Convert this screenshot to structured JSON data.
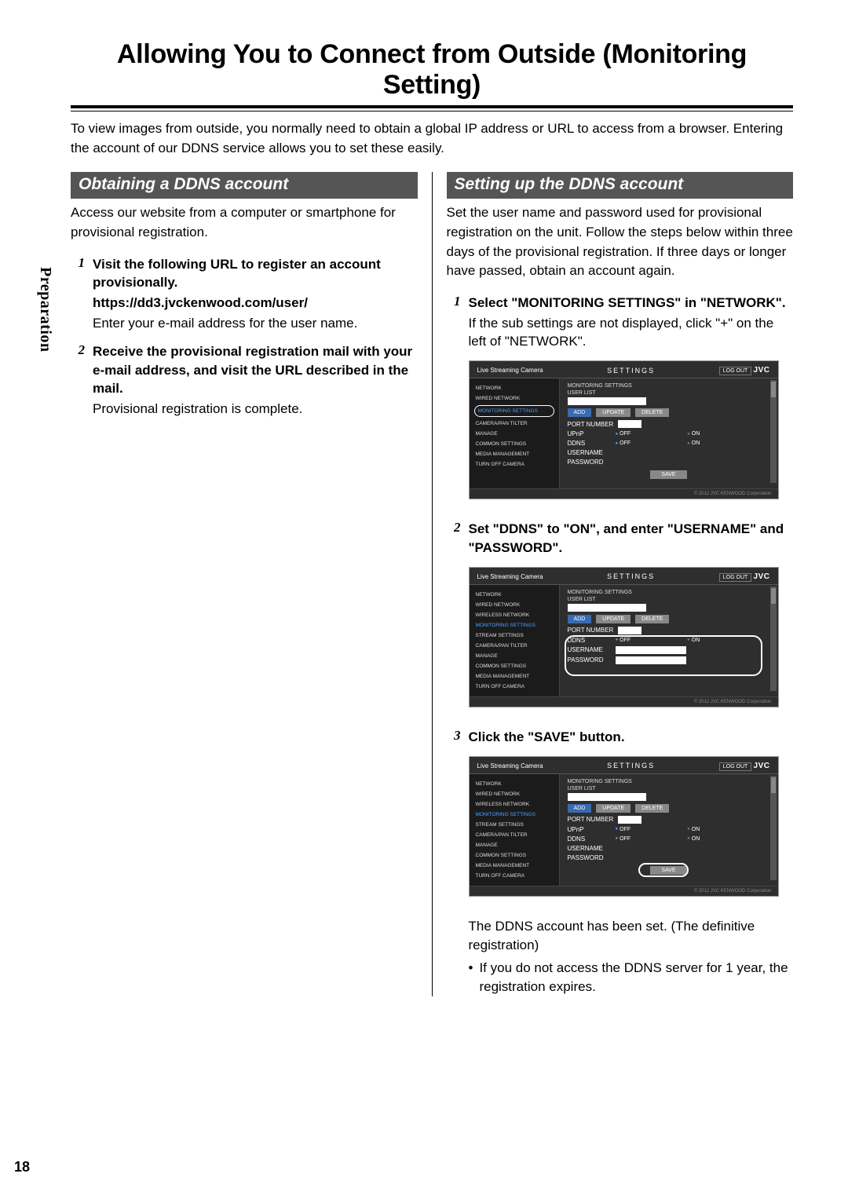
{
  "page_number": "18",
  "side_tab": "Preparation",
  "page_title": "Allowing You to Connect from Outside (Monitoring Setting)",
  "intro": "To view images from outside, you normally need to obtain a global IP address or URL to access from a browser. Entering the account of our DDNS service allows you to set these easily.",
  "left": {
    "header": "Obtaining a DDNS account",
    "lead": "Access our website from a computer or smartphone for provisional registration.",
    "steps": [
      {
        "num": "1",
        "title": "Visit the following URL to register an account provisionally.",
        "url": "https://dd3.jvckenwood.com/user/",
        "note": "Enter your e-mail address for the user name."
      },
      {
        "num": "2",
        "title": "Receive the provisional registration mail with your e-mail address, and visit the URL described in the mail.",
        "note": "Provisional registration is complete."
      }
    ]
  },
  "right": {
    "header": "Setting up the DDNS account",
    "lead": "Set the user name and password used for provisional registration on the unit. Follow the steps below within three days of the provisional registration. If three days or longer have passed, obtain an account again.",
    "steps": [
      {
        "num": "1",
        "title": "Select \"MONITORING SETTINGS\" in \"NETWORK\".",
        "sub": "If the sub settings are not displayed, click \"+\" on the left of \"NETWORK\"."
      },
      {
        "num": "2",
        "title": "Set \"DDNS\" to \"ON\", and enter \"USERNAME\" and \"PASSWORD\"."
      },
      {
        "num": "3",
        "title": "Click the \"SAVE\" button.",
        "after": "The DDNS account has been set. (The definitive registration)",
        "bullet": "If you do not access the DDNS server for 1 year, the registration expires."
      }
    ]
  },
  "shot": {
    "product": "Live Streaming Camera",
    "settings": "SETTINGS",
    "logout": "LOG OUT",
    "brand": "JVC",
    "mon_settings": "MONITORING SETTINGS",
    "userlist": "USER LIST",
    "username_lbl": "USERNAME",
    "add": "ADD",
    "update": "UPDATE",
    "delete": "DELETE",
    "portnumber": "PORT NUMBER",
    "upnp": "UPnP",
    "ddns": "DDNS",
    "password": "PASSWORD",
    "save": "SAVE",
    "off": "OFF",
    "on": "ON",
    "copy": "© 2012 JVC KENWOOD Corporation",
    "side": {
      "network": "NETWORK",
      "wired": "WIRED NETWORK",
      "wireless": "WIRELESS NETWORK",
      "monitoring": "MONITORING SETTINGS",
      "stream": "STREAM SETTINGS",
      "camfilter": "CAMERA/PAN TILTER",
      "manage": "MANAGE",
      "common": "COMMON SETTINGS",
      "media": "MEDIA MANAGEMENT",
      "turnoff": "TURN OFF CAMERA"
    }
  }
}
